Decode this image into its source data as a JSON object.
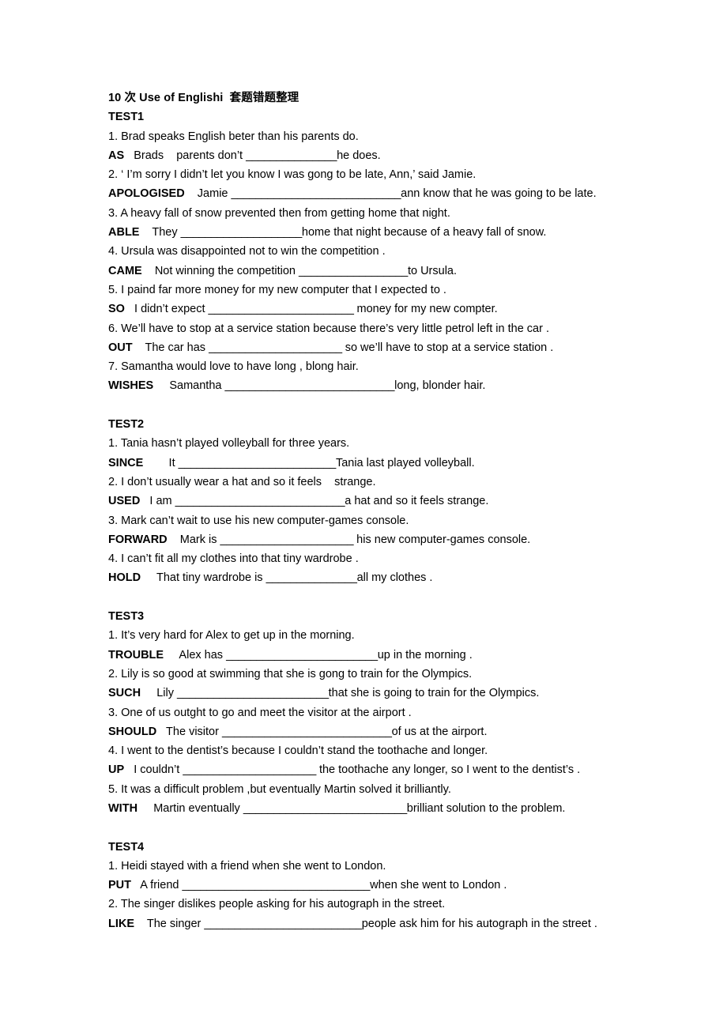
{
  "document": {
    "title": "10 次 Use of Englishi  套题错题整理",
    "sections": [
      {
        "heading": "TEST1",
        "items": [
          {
            "prompt": "1. Brad speaks English beter than his parents do.",
            "keyword": "AS",
            "answer_before": "   Brads    parents don’t ",
            "blank": "_______________",
            "answer_after": "he does."
          },
          {
            "prompt": "2. ‘ I’m sorry I didn’t let you know I was gong to be late, Ann,’ said Jamie.",
            "keyword": "APOLOGISED",
            "answer_before": "    Jamie ",
            "blank": "____________________________",
            "answer_after": "ann know that he was going to be late."
          },
          {
            "prompt": "3. A heavy fall of snow prevented then from getting home that night.",
            "keyword": "ABLE",
            "answer_before": "    They ",
            "blank": "____________________",
            "answer_after": "home that night because of a heavy fall of snow."
          },
          {
            "prompt": "4. Ursula was disappointed not to win the competition .",
            "keyword": "CAME",
            "answer_before": "    Not winning the competition ",
            "blank": "__________________",
            "answer_after": "to Ursula."
          },
          {
            "prompt": "5. I paind far more money for my new computer that I expected to .",
            "keyword": "SO",
            "answer_before": "   I didn’t expect ",
            "blank": "________________________",
            "answer_after": " money for my new compter."
          },
          {
            "prompt": "6. We’ll have to stop at a service station because there’s very little petrol left in the car .",
            "keyword": "OUT",
            "answer_before": "    The car has ",
            "blank": "______________________",
            "answer_after": " so we’ll have to stop at a service station ."
          },
          {
            "prompt": "7. Samantha would love to have long , blong hair.",
            "keyword": "WISHES",
            "answer_before": "     Samantha ",
            "blank": "____________________________",
            "answer_after": "long, blonder hair."
          }
        ]
      },
      {
        "heading": "TEST2",
        "items": [
          {
            "prompt": "1. Tania hasn’t played volleyball for three years.",
            "keyword": "SINCE",
            "answer_before": "        It ",
            "blank": "__________________________",
            "answer_after": "Tania last played volleyball."
          },
          {
            "prompt": "2. I don’t usually wear a hat and so it feels    strange.",
            "keyword": "USED",
            "answer_before": "   I am ",
            "blank": "____________________________",
            "answer_after": "a hat and so it feels strange."
          },
          {
            "prompt": "3. Mark can’t wait to use his new computer-games console.",
            "keyword": "FORWARD",
            "answer_before": "    Mark is ",
            "blank": "______________________",
            "answer_after": " his new computer-games console."
          },
          {
            "prompt": "4. I can’t fit all my clothes into that tiny wardrobe .",
            "keyword": "HOLD",
            "answer_before": "     That tiny wardrobe is ",
            "blank": "_______________",
            "answer_after": "all my clothes ."
          }
        ]
      },
      {
        "heading": "TEST3",
        "items": [
          {
            "prompt": "1. It’s very hard for Alex to get up in the morning.",
            "keyword": "TROUBLE",
            "answer_before": "     Alex has ",
            "blank": "_________________________",
            "answer_after": "up in the morning ."
          },
          {
            "prompt": "2. Lily is so good at swimming that she is gong to train for the Olympics.",
            "keyword": "SUCH",
            "answer_before": "     Lily ",
            "blank": "_________________________",
            "answer_after": "that she is going to train for the Olympics."
          },
          {
            "prompt": "3. One of us outght to go and meet the visitor at the airport .",
            "keyword": "SHOULD",
            "answer_before": "   The visitor ",
            "blank": "____________________________",
            "answer_after": "of us at the airport."
          },
          {
            "prompt": "4. I went to the dentist’s because I couldn’t stand the toothache and longer.",
            "keyword": "UP",
            "answer_before": "   I couldn’t ",
            "blank": "______________________",
            "answer_after": " the toothache any longer, so I went to the dentist’s ."
          },
          {
            "prompt": "5. It was a difficult problem ,but eventually Martin solved it brilliantly.",
            "keyword": "WITH",
            "answer_before": "     Martin eventually ",
            "blank": "___________________________",
            "answer_after": "brilliant solution to the problem."
          }
        ]
      },
      {
        "heading": "TEST4",
        "items": [
          {
            "prompt": "1. Heidi stayed with a friend when she went to London.",
            "keyword": "PUT",
            "answer_before": "   A friend ",
            "blank": "_______________________________",
            "answer_after": "when she went to London ."
          },
          {
            "prompt": "2. The singer dislikes people asking for his autograph in the street.",
            "keyword": "LIKE",
            "answer_before": "    The singer ",
            "blank": "__________________________",
            "answer_after": "people ask him for his autograph in the street ."
          }
        ]
      }
    ]
  }
}
